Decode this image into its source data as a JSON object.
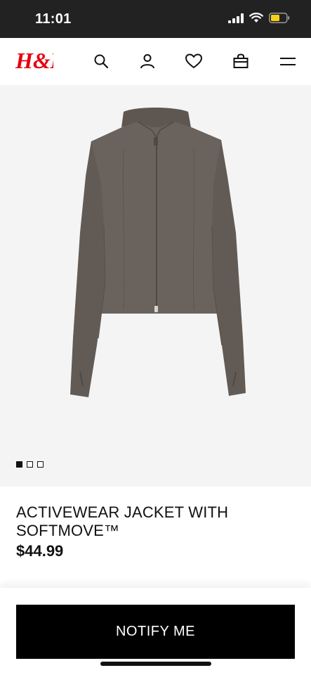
{
  "status_bar": {
    "time": "11:01",
    "battery_color": "#f5d218"
  },
  "header": {
    "logo": "H&M",
    "brand_color": "#e50010",
    "icons": [
      "search-icon",
      "account-icon",
      "heart-icon",
      "bag-icon",
      "menu-icon"
    ]
  },
  "product": {
    "title": "ACTIVEWEAR JACKET WITH SOFTMOVE™",
    "price": "$44.99",
    "color": "#6a635d",
    "gallery": {
      "total": 3,
      "current": 1
    }
  },
  "cta": {
    "notify_label": "NOTIFY ME"
  }
}
